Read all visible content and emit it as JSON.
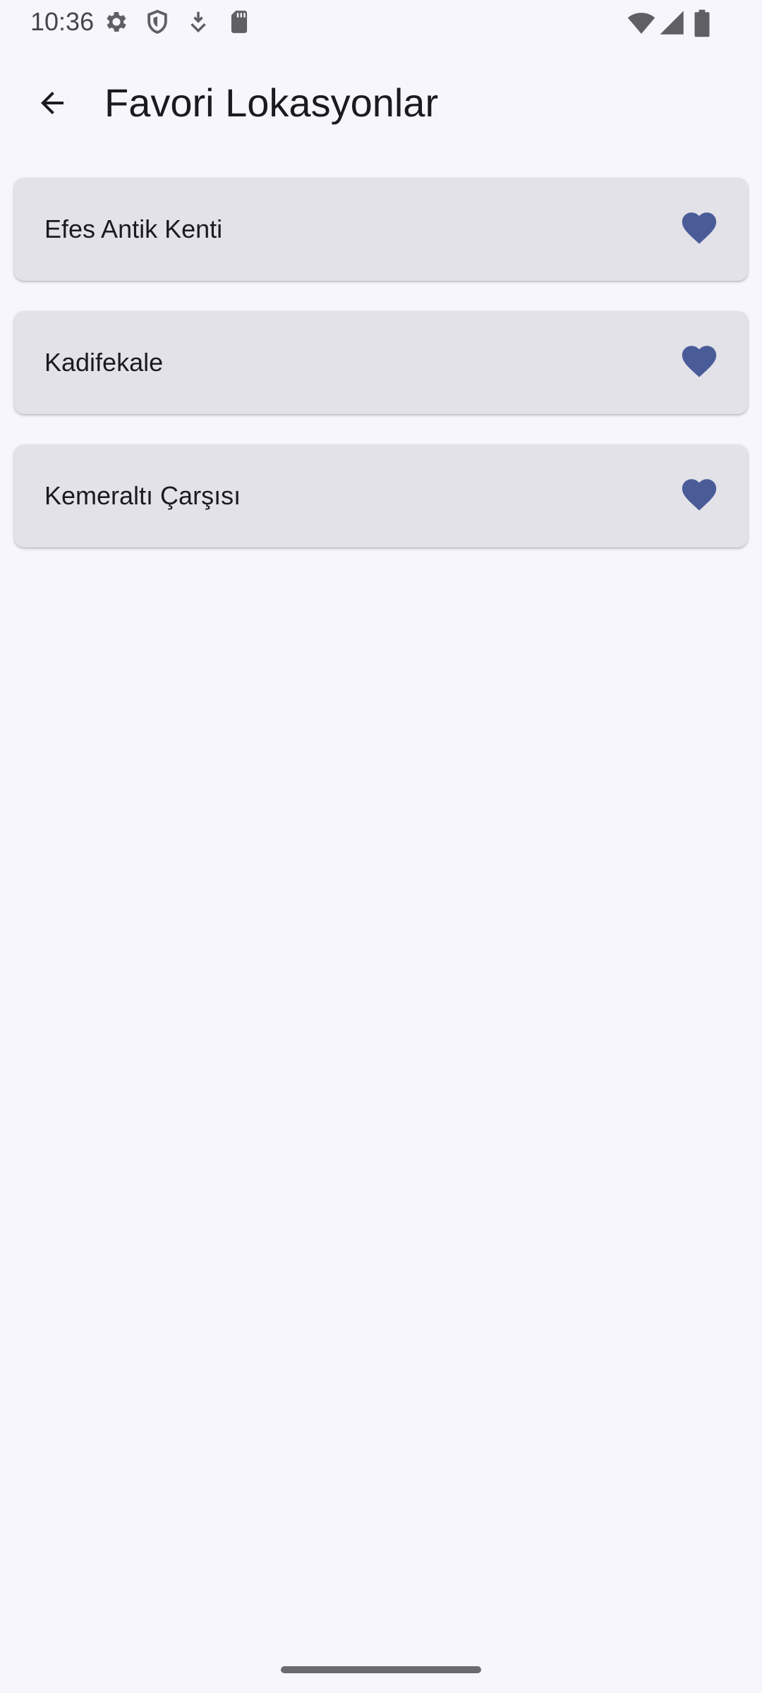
{
  "status_bar": {
    "time": "10:36",
    "left_icons": [
      "gear-icon",
      "shield-icon",
      "download-icon",
      "sd-card-icon"
    ],
    "right_icons": [
      "wifi-icon",
      "signal-icon",
      "battery-icon"
    ]
  },
  "app_bar": {
    "back_icon": "arrow-left-icon",
    "title": "Favori Lokasyonlar"
  },
  "favorites": [
    {
      "name": "Efes Antik Kenti",
      "favorite": true
    },
    {
      "name": "Kadifekale",
      "favorite": true
    },
    {
      "name": "Kemeraltı Çarşısı",
      "favorite": true
    }
  ],
  "colors": {
    "background": "#f7f6fc",
    "card": "#e3e2e8",
    "heart": "#4a5c98",
    "text": "#1b1b1f"
  }
}
